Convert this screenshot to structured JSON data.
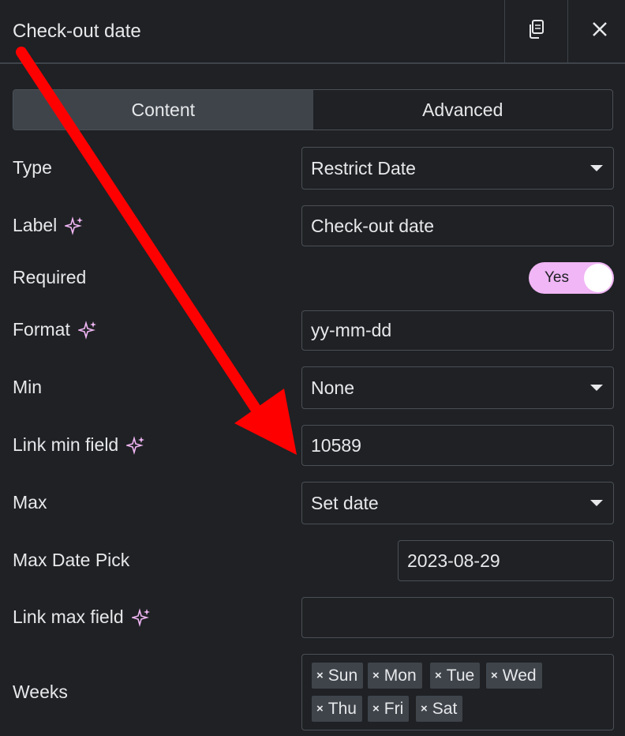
{
  "header": {
    "title": "Check-out date",
    "icons": {
      "copy": "copy-icon",
      "close": "close-icon"
    }
  },
  "tabs": [
    {
      "label": "Content",
      "active": true
    },
    {
      "label": "Advanced",
      "active": false
    }
  ],
  "fields": {
    "type": {
      "label": "Type",
      "value": "Restrict Date"
    },
    "label": {
      "label": "Label",
      "value": "Check-out date"
    },
    "required": {
      "label": "Required",
      "toggle_text": "Yes",
      "checked": true
    },
    "format": {
      "label": "Format",
      "value": "yy-mm-dd"
    },
    "min": {
      "label": "Min",
      "value": "None"
    },
    "link_min_field": {
      "label": "Link min field",
      "value": "10589"
    },
    "max": {
      "label": "Max",
      "value": "Set date"
    },
    "max_date_pick": {
      "label": "Max Date Pick",
      "value": "2023-08-29"
    },
    "link_max_field": {
      "label": "Link max field",
      "value": ""
    },
    "weeks": {
      "label": "Weeks",
      "chips": [
        "Sun",
        "Mon",
        "Tue",
        "Wed",
        "Thu",
        "Fri",
        "Sat"
      ]
    }
  },
  "colors": {
    "background": "#1f2124",
    "border": "#4b5057",
    "accent_pink": "#f0b6f5",
    "annotation_red": "#ff0000"
  }
}
